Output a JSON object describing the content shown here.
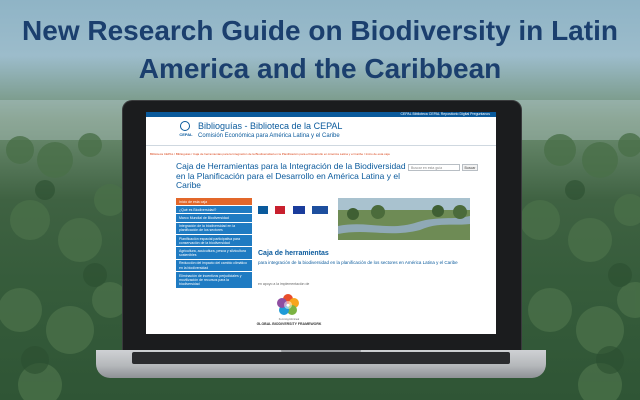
{
  "headline": "New Research Guide on Biodiversity in Latin America and the Caribbean",
  "website": {
    "top_links": "CEPAL   Biblioteca CEPAL   Repositorio Digital   Preguntanos",
    "logo_text": "CEPAL",
    "site_title": "Biblioguías - Biblioteca de la CEPAL",
    "site_subtitle": "Comisión Económica para América Latina y el Caribe",
    "breadcrumb": "Biblioteca CEPAL / Biblioguías / Caja de herramientas para la Integración de la Biodiversidad en la Planificación para el Desarrollo en América Latina y el Caribe / Inicio de esta caja",
    "search_placeholder": "Buscar en esta guía",
    "search_button": "Buscar",
    "page_title": "Caja de Herramientas para la Integración de la Biodiversidad en la Planificación para el Desarrollo en América Latina y el Caribe",
    "nav_items": [
      "Inicio de esta caja",
      "¿Qué es Biodiversidad?",
      "Marco Mundial de Biodiversidad",
      "Integración de la biodiversidad en la planificación de los sectores",
      "Planificación espacial participativa para conservación de la biodiversidad",
      "Agricultura, acuicultura, pesca y silvicultura sostenibles",
      "Reducción del impacto del cambio climático en la biodiversidad",
      "Eliminación de incentivos perjudiciales y movilización de recursos para la biodiversidad"
    ],
    "caja_title": "Caja de herramientas",
    "caja_subtitle": "para integración de la biodiversidad en la planificación de los sectores en América Latina y el Caribe",
    "en_apoyo": "en apoyo a la implementación de",
    "gbf_small": "Kunming-Montreal",
    "gbf_text": "GLOBAL BIODIVERSITY FRAMEWORK"
  },
  "colors": {
    "headline": "#1b3f6e",
    "brand_blue": "#0a5a9c",
    "nav_blue": "#1f7bc2",
    "nav_active": "#e2672a"
  }
}
